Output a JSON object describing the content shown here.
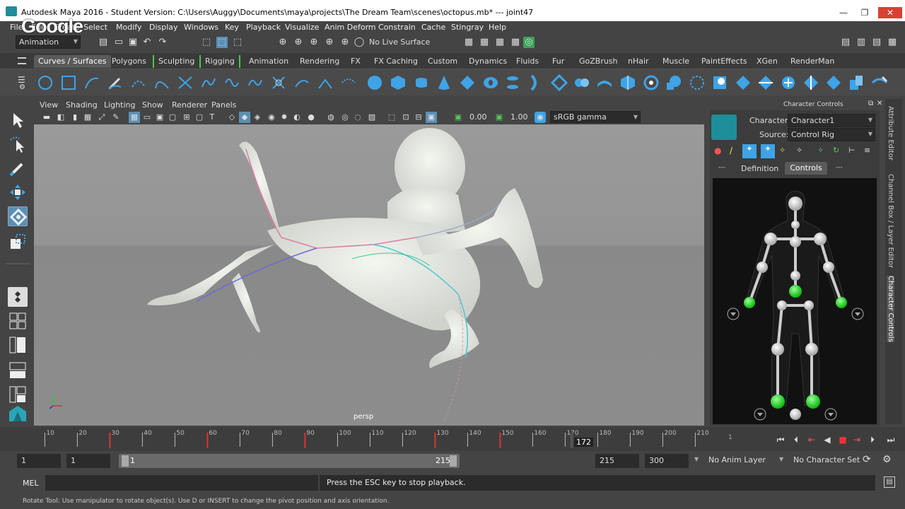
{
  "window": {
    "title": "Autodesk Maya 2016 - Student Version: C:\\Users\\Auggy\\Documents\\maya\\projects\\The Dream Team\\scenes\\octopus.mb*  ---  joint47",
    "minimize": "—",
    "maximize": "❐",
    "close": "✕"
  },
  "watermark": "Google",
  "menubar": [
    "File",
    "Edit",
    "Create",
    "Select",
    "Modify",
    "Display",
    "Windows",
    "Key",
    "Playback",
    "Visualize",
    "Anim Deform",
    "Constrain",
    "Cache",
    "Stingray",
    "Help"
  ],
  "statusline": {
    "menu_set": "Animation",
    "live_surface": "No Live Surface"
  },
  "shelf_tabs": [
    "Curves / Surfaces",
    "Polygons",
    "Sculpting",
    "Rigging",
    "Animation",
    "Rendering",
    "FX",
    "FX Caching",
    "Custom",
    "Dynamics",
    "Fluids",
    "Fur",
    "GoZBrush",
    "nHair",
    "Muscle",
    "PaintEffects",
    "XGen",
    "RenderMan"
  ],
  "viewport": {
    "menus": [
      "View",
      "Shading",
      "Lighting",
      "Show",
      "Renderer",
      "Panels"
    ],
    "near_value": "0.00",
    "far_value": "1.00",
    "color_space": "sRGB gamma",
    "camera_label": "persp"
  },
  "character_controls": {
    "panel_title": "Character Controls",
    "character_label": "Character:",
    "character_value": "Character1",
    "source_label": "Source:",
    "source_value": "Control Rig",
    "tab_definition": "Definition",
    "tab_controls": "Controls",
    "tab_dots_left": "---",
    "tab_dots_right": "---"
  },
  "side_tabs": [
    "Attribute Editor",
    "Channel Box / Layer Editor",
    "Character Controls"
  ],
  "time_slider": {
    "ticks": [
      "10",
      "20",
      "30",
      "40",
      "50",
      "60",
      "70",
      "80",
      "90",
      "100",
      "110",
      "120",
      "130",
      "140",
      "150",
      "160",
      "170",
      "180",
      "190",
      "200",
      "210"
    ],
    "current_frame": "172",
    "end_marker": "1"
  },
  "range": {
    "start": "1",
    "playback_start": "1",
    "slider_start": "1",
    "slider_end": "215",
    "playback_end": "215",
    "end": "300",
    "anim_layer": "No Anim Layer",
    "character_set": "No Character Set"
  },
  "command_line": {
    "language": "MEL",
    "result": "Press the ESC key to stop playback."
  },
  "help_line": "Rotate Tool: Use manipulator to rotate object(s). Use D or INSERT to change the pivot position and axis orientation."
}
